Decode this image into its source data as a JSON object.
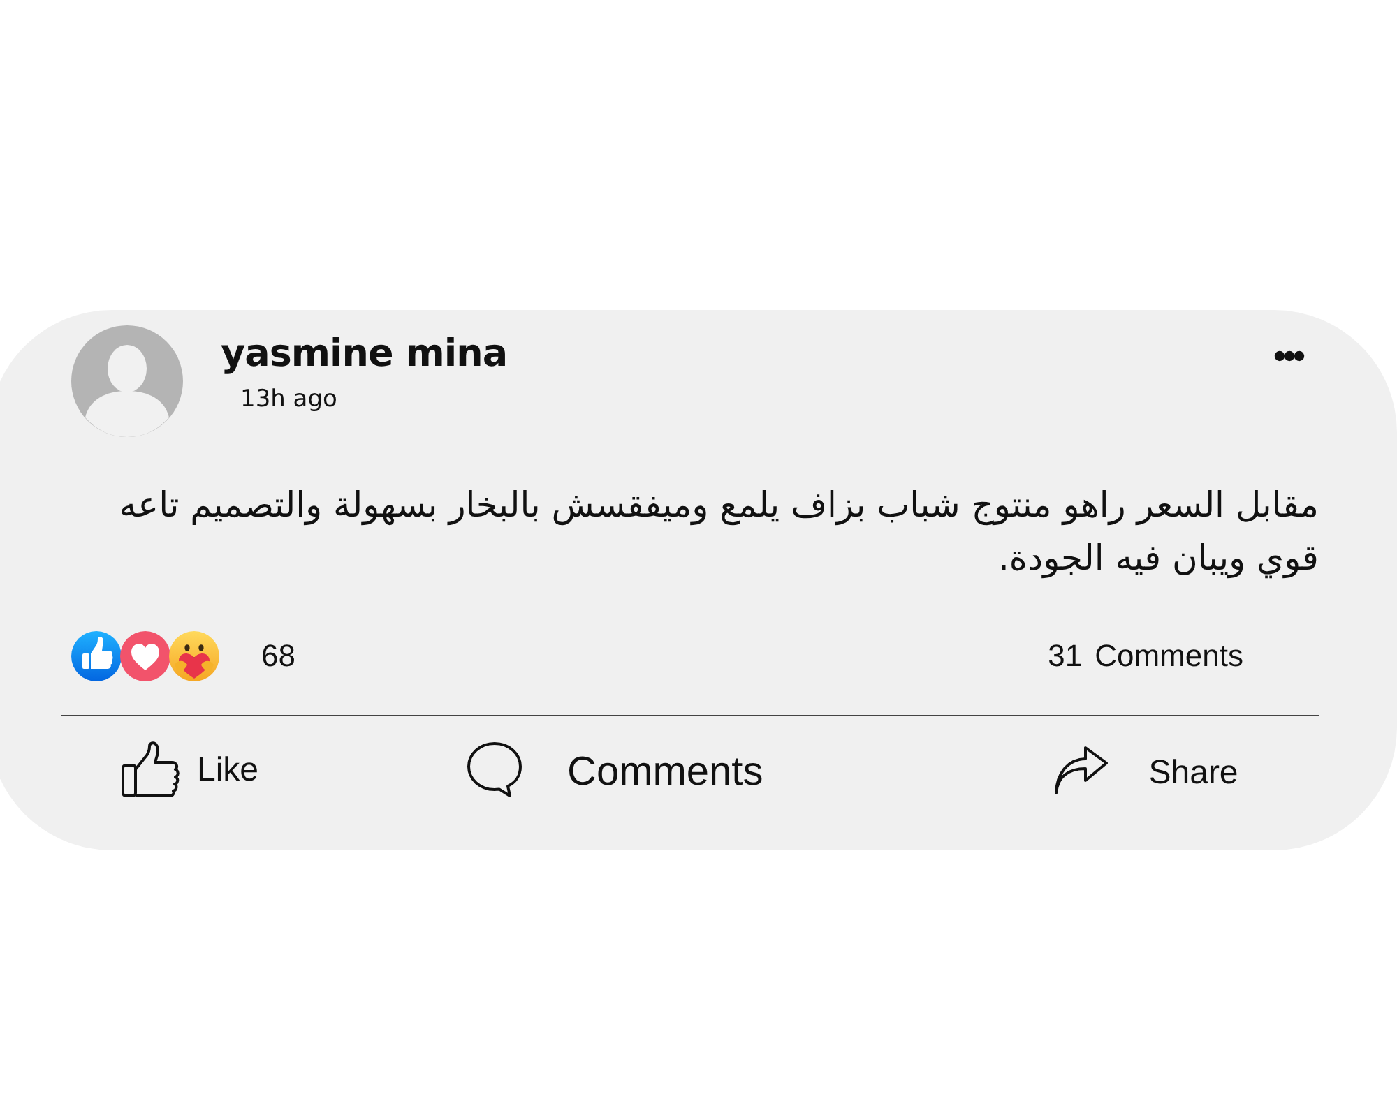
{
  "post": {
    "author": "yasmine mina",
    "time": "13h ago",
    "text": "مقابل السعر راهو منتوج شباب بزاف يلمع وميفقسش بالبخار بسهولة والتصميم تاعه قوي ويبان فيه الجودة."
  },
  "reactions": {
    "items": [
      {
        "kind": "like"
      },
      {
        "kind": "love"
      },
      {
        "kind": "care"
      }
    ],
    "count": "68"
  },
  "comments_summary": {
    "count": "31",
    "label": "Comments"
  },
  "actions": [
    {
      "kind": "like",
      "label": "Like"
    },
    {
      "kind": "comment",
      "label": "Comments"
    },
    {
      "kind": "share",
      "label": "Share"
    }
  ]
}
